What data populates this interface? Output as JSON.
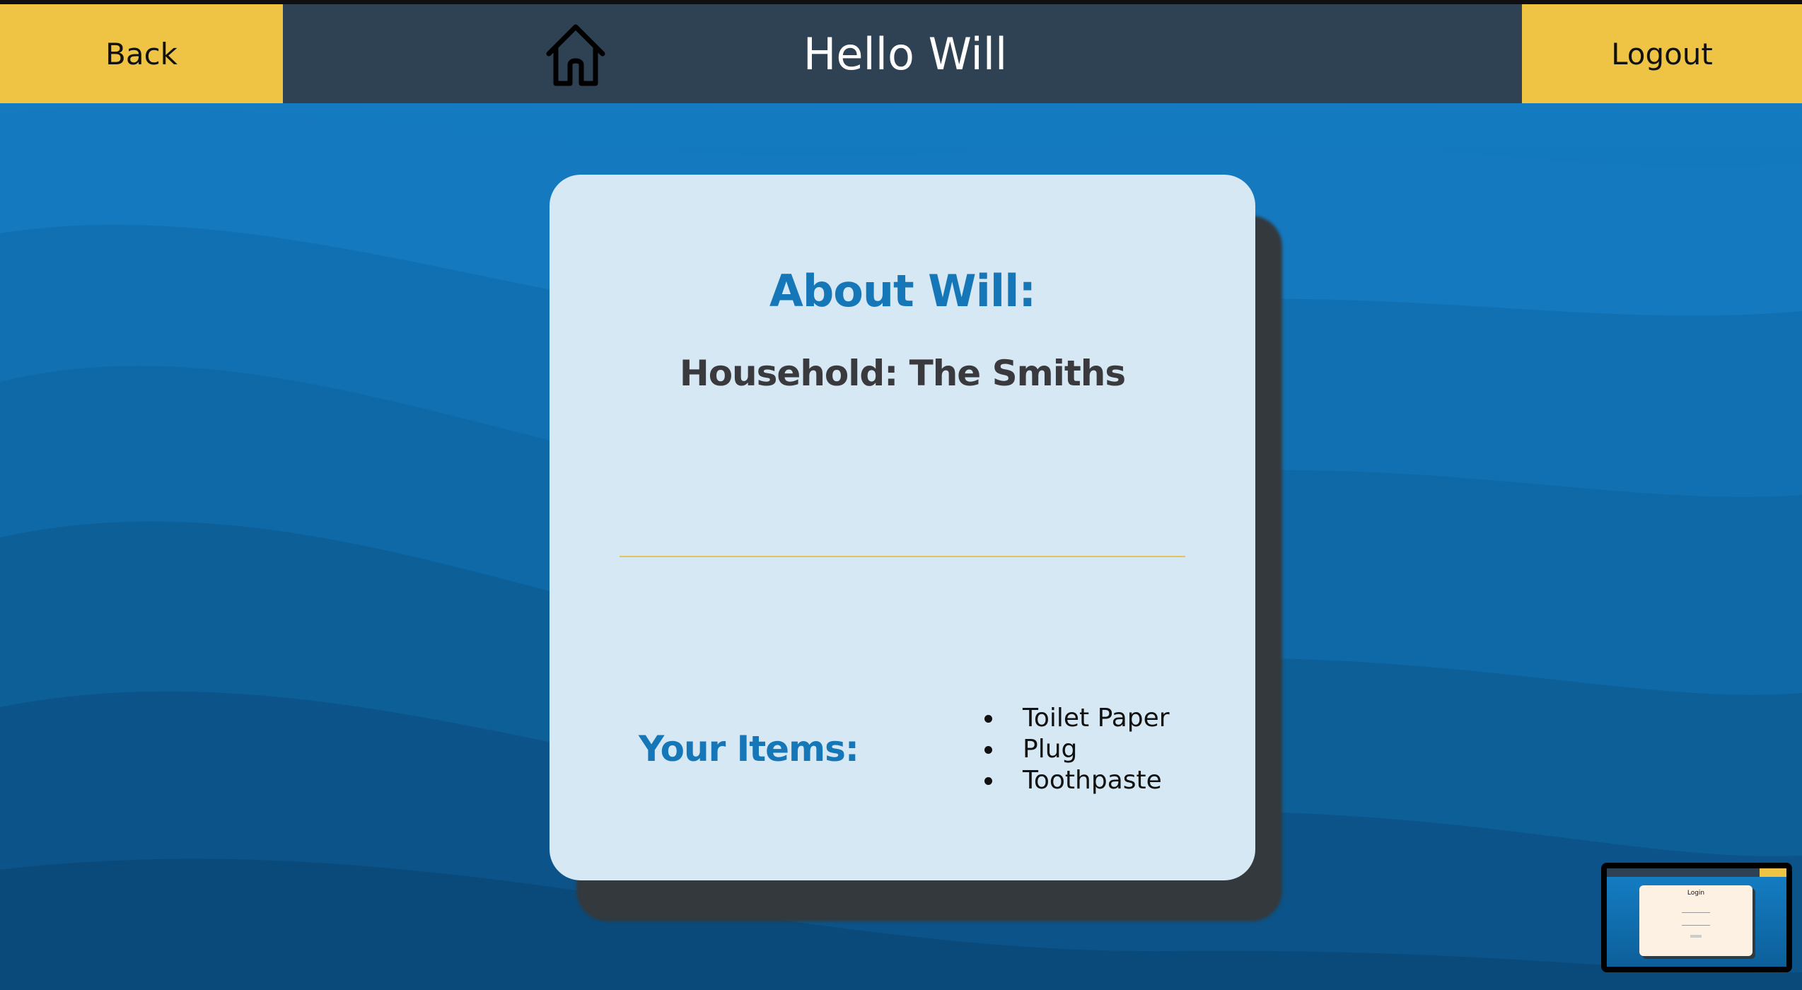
{
  "header": {
    "back_label": "Back",
    "greeting": "Hello Will",
    "logout_label": "Logout",
    "home_icon": "home-icon"
  },
  "card": {
    "about_title": "About Will:",
    "household": "Household: The Smiths",
    "items_label": "Your Items:",
    "items": [
      "Toilet Paper",
      "Plug",
      "Toothpaste"
    ]
  },
  "thumbnail": {
    "title": "Login"
  },
  "colors": {
    "header_bg": "#2f4254",
    "accent_yellow": "#efc344",
    "background_blue": "#1072b6",
    "card_bg": "#d6e8f4",
    "title_blue": "#1677b8",
    "divider": "#e5c35a"
  }
}
